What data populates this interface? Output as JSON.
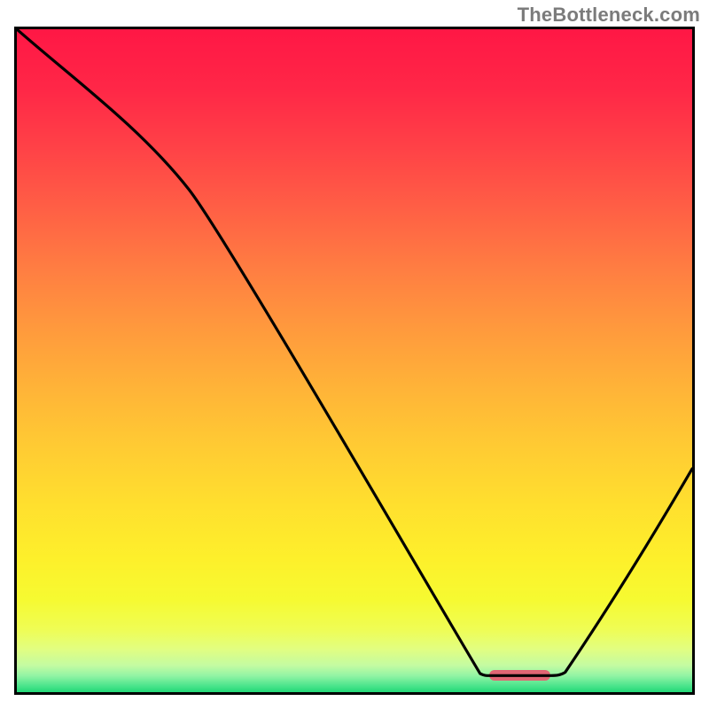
{
  "watermark": {
    "text": "TheBottleneck.com"
  },
  "frame": {
    "inner_width": 762,
    "inner_height": 748
  },
  "marker_rel": {
    "x_start": 0.7,
    "x_end": 0.79,
    "y": 0.975
  },
  "gradient_stops": [
    {
      "offset": 0.0,
      "color": "#ff1745"
    },
    {
      "offset": 0.09,
      "color": "#ff2747"
    },
    {
      "offset": 0.18,
      "color": "#ff4247"
    },
    {
      "offset": 0.27,
      "color": "#ff5f45"
    },
    {
      "offset": 0.36,
      "color": "#ff7d42"
    },
    {
      "offset": 0.45,
      "color": "#ff993d"
    },
    {
      "offset": 0.54,
      "color": "#ffb338"
    },
    {
      "offset": 0.63,
      "color": "#ffcb33"
    },
    {
      "offset": 0.72,
      "color": "#ffe02e"
    },
    {
      "offset": 0.8,
      "color": "#fdf02b"
    },
    {
      "offset": 0.86,
      "color": "#f6fa31"
    },
    {
      "offset": 0.905,
      "color": "#effd54"
    },
    {
      "offset": 0.935,
      "color": "#e2fe81"
    },
    {
      "offset": 0.96,
      "color": "#c3fba2"
    },
    {
      "offset": 0.975,
      "color": "#93f4a4"
    },
    {
      "offset": 0.99,
      "color": "#4de58d"
    },
    {
      "offset": 1.0,
      "color": "#23d877"
    }
  ],
  "chart_data": {
    "type": "line",
    "title": "",
    "xlabel": "",
    "ylabel": "",
    "xlim": [
      0,
      1
    ],
    "ylim": [
      0,
      1
    ],
    "series": [
      {
        "name": "bottleneck-curve",
        "method": "cubic-bezier-segments",
        "anchors": [
          {
            "x": 0.0,
            "y": 1.0
          },
          {
            "x": 0.255,
            "y": 0.758
          },
          {
            "x": 0.686,
            "y": 0.028
          },
          {
            "x": 0.7,
            "y": 0.025
          },
          {
            "x": 0.79,
            "y": 0.025
          },
          {
            "x": 0.812,
            "y": 0.03
          },
          {
            "x": 1.0,
            "y": 0.337
          }
        ],
        "controls": [
          {
            "c1x": 0.08,
            "c1y": 0.928,
            "c2x": 0.183,
            "c2y": 0.852
          },
          {
            "c1x": 0.312,
            "c1y": 0.683,
            "c2x": 0.609,
            "c2y": 0.159
          },
          {
            "c1x": 0.692,
            "c1y": 0.025,
            "c2x": 0.695,
            "c2y": 0.025
          },
          {
            "c1x": 0.73,
            "c1y": 0.025,
            "c2x": 0.76,
            "c2y": 0.025
          },
          {
            "c1x": 0.8,
            "c1y": 0.025,
            "c2x": 0.806,
            "c2y": 0.026
          },
          {
            "c1x": 0.873,
            "c1y": 0.122,
            "c2x": 0.94,
            "c2y": 0.232
          }
        ]
      }
    ],
    "marker": {
      "x_start": 0.7,
      "x_end": 0.79,
      "y": 0.025,
      "color": "#e06674"
    }
  }
}
